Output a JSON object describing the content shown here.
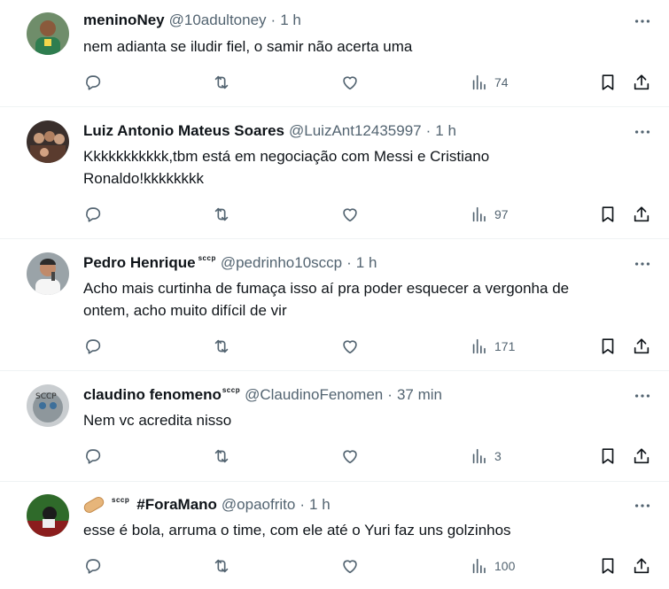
{
  "tweets": [
    {
      "name": "meninoNey",
      "badge": "",
      "handle": "@10adultoney",
      "time": "1 h",
      "text_lines": [
        "nem adianta se iludir fiel, o samir não acerta uma"
      ],
      "views": "74"
    },
    {
      "name": "Luiz Antonio Mateus Soares",
      "badge": "",
      "handle": "@LuizAnt12435997",
      "time": "1 h",
      "text_lines": [
        "Kkkkkkkkkkk,tbm está em negociação com Messi e Cristiano",
        "Ronaldo!kkkkkkkk"
      ],
      "views": "97"
    },
    {
      "name": "Pedro Henrique",
      "badge": "sccp",
      "handle": "@pedrinho10sccp",
      "time": "1 h",
      "text_lines": [
        "Acho mais curtinha de fumaça isso aí pra poder esquecer a vergonha de",
        "ontem, acho muito difícil de vir"
      ],
      "views": "171"
    },
    {
      "name": "claudino fenomeno",
      "badge": "sccp",
      "handle": "@ClaudinoFenomen",
      "time": "37 min",
      "text_lines": [
        "Nem vc acredita nisso"
      ],
      "views": "3"
    },
    {
      "name": "#ForaMano",
      "badge_prefix": "sccp",
      "handle": "@opaofrito",
      "time": "1 h",
      "text_lines": [
        "esse é bola, arruma o time, com ele até o Yuri faz uns golzinhos"
      ],
      "views": "100"
    }
  ],
  "separator": "·",
  "icons": {
    "reply": "reply-icon",
    "retweet": "retweet-icon",
    "like": "like-icon",
    "views": "views-icon",
    "bookmark": "bookmark-icon",
    "share": "share-icon",
    "more": "more-icon"
  },
  "colors": {
    "text": "#0f1419",
    "secondary": "#536471",
    "divider": "#eff3f4"
  }
}
